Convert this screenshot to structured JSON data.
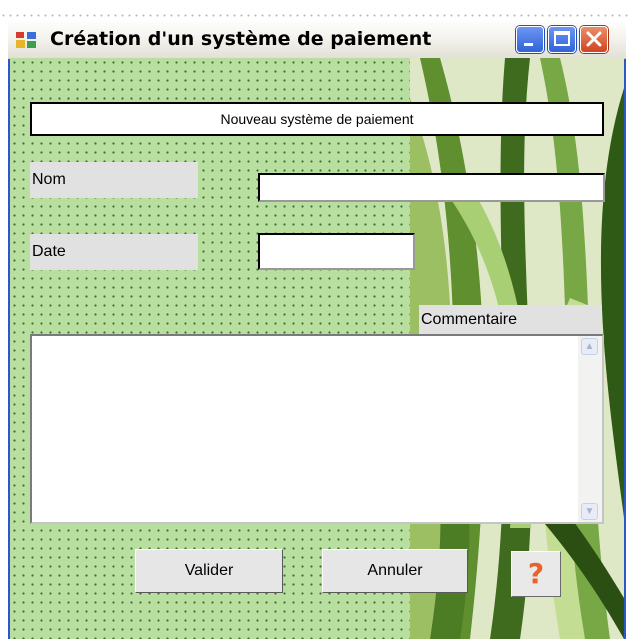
{
  "window": {
    "title": "Création d'un système de paiement"
  },
  "form": {
    "header": "Nouveau système de paiement",
    "nom_label": "Nom",
    "nom_value": "",
    "date_label": "Date",
    "date_value": "",
    "commentaire_label": "Commentaire",
    "commentaire_value": ""
  },
  "buttons": {
    "valider": "Valider",
    "annuler": "Annuler",
    "help": "?"
  },
  "colors": {
    "form_background": "#b9dfa0",
    "title_bar_border": "#2c57c8",
    "help_icon": "#e8632b"
  }
}
